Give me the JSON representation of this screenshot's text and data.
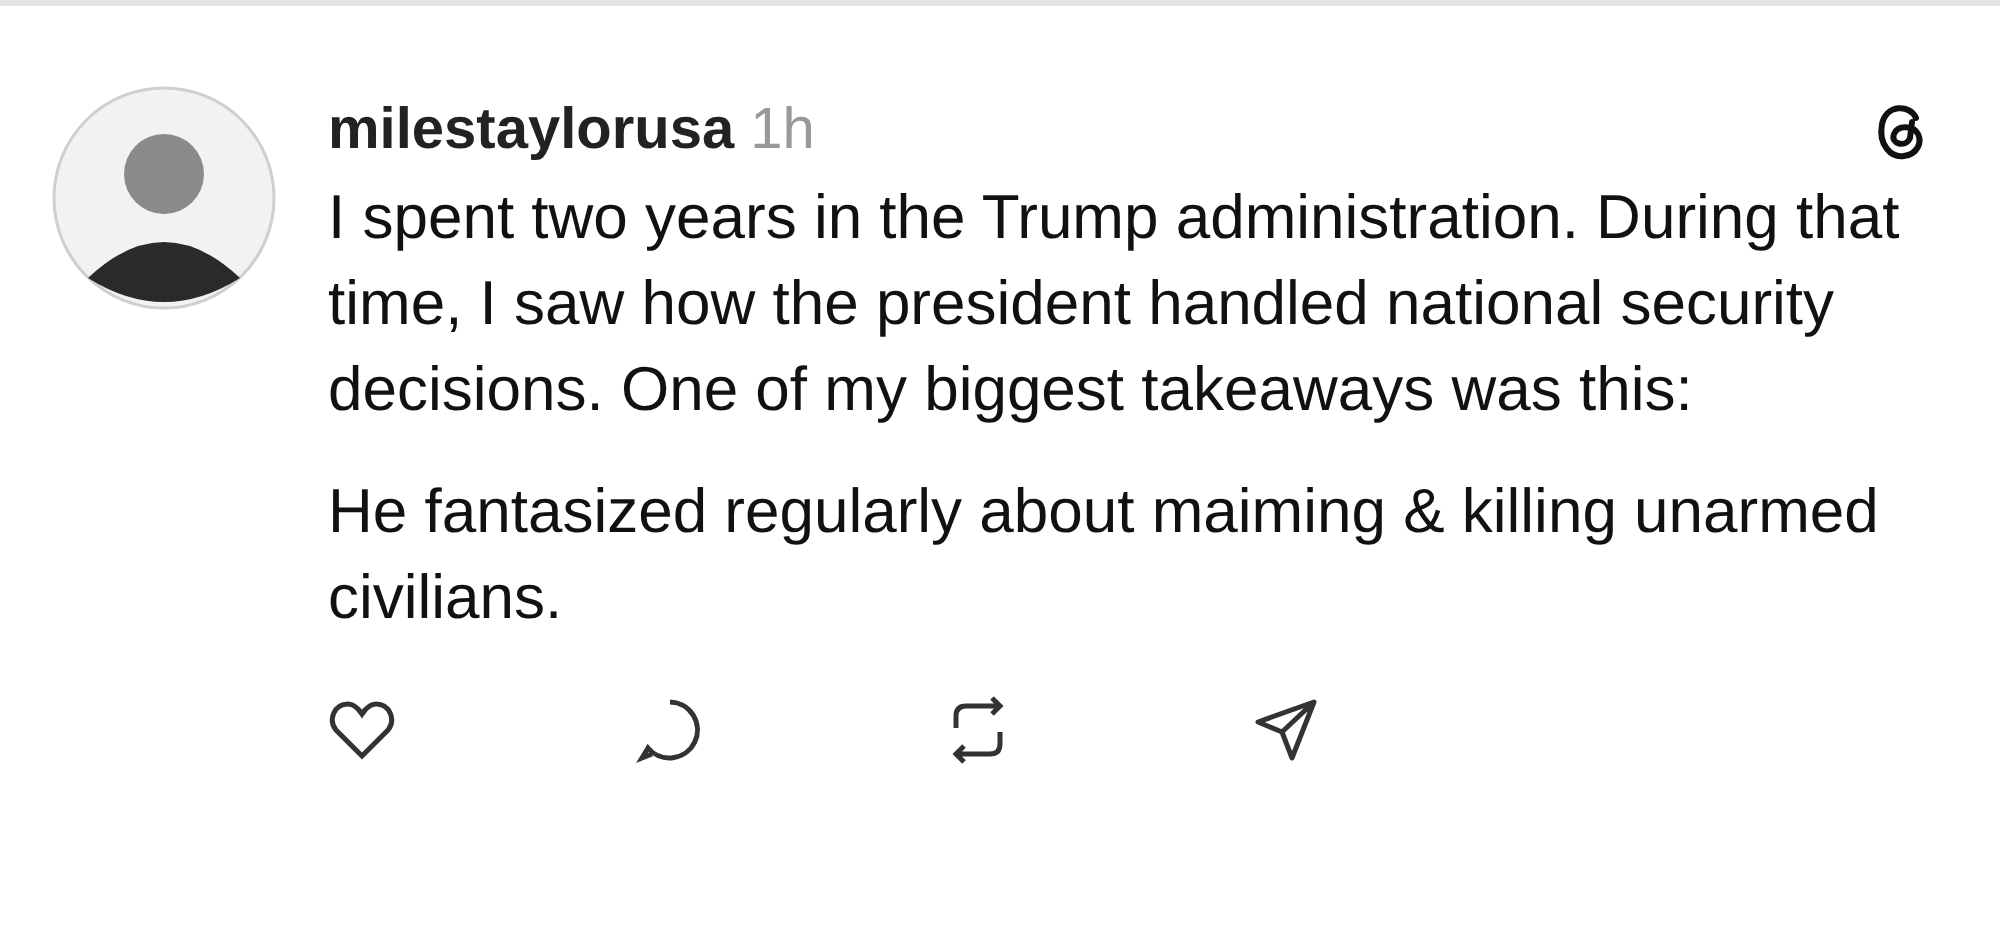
{
  "post": {
    "username": "milestaylorusa",
    "time": "1h",
    "paragraphs": [
      "I spent two years in the Trump administration. During that time, I saw how the president handled national security decisions. One of my biggest takeaways was this:",
      "He fantasized regularly about maiming & killing unarmed civilians."
    ]
  }
}
